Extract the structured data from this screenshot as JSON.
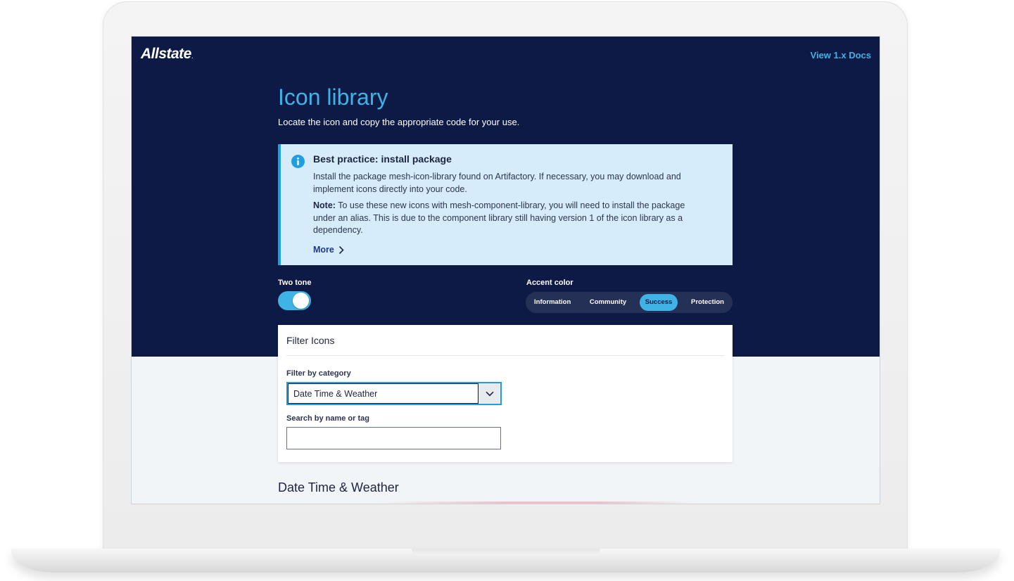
{
  "header": {
    "brand": "Allstate",
    "docs_link": "View 1.x Docs"
  },
  "page": {
    "title": "Icon library",
    "subtitle": "Locate the icon and copy the appropriate code for your use."
  },
  "callout": {
    "icon": "info-icon",
    "title": "Best practice: install package",
    "paragraph1": "Install the package mesh-icon-library found on Artifactory. If necessary, you may download and implement icons directly into your code.",
    "note_label": "Note:",
    "note_text": " To use these new icons with mesh-component-library, you will need to install the package under an alias. This is due to the component library still having version 1 of the icon library as a dependency.",
    "more_label": "More"
  },
  "controls": {
    "two_tone_label": "Two tone",
    "two_tone_on": true,
    "accent_label": "Accent color",
    "accent_options": [
      "Information",
      "Community",
      "Success",
      "Protection"
    ],
    "accent_selected": "Success"
  },
  "filter": {
    "title": "Filter Icons",
    "category_label": "Filter by category",
    "category_value": "Date Time & Weather",
    "search_label": "Search by name or tag",
    "search_value": ""
  },
  "results": {
    "heading": "Date Time & Weather"
  },
  "colors": {
    "navy": "#0d1a45",
    "accent_blue": "#3fb3e6",
    "callout_bg": "#d6ecfb"
  }
}
